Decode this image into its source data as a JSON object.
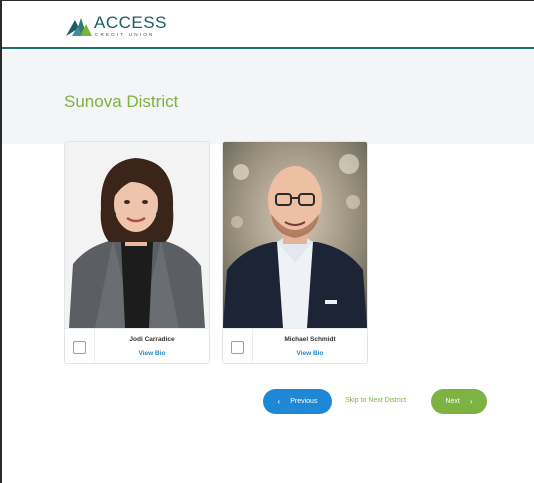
{
  "brand": {
    "name": "ACCESS",
    "subtitle": "CREDIT UNION",
    "colors": {
      "primary": "#1d5b66",
      "accent_green": "#7cb342",
      "accent_blue": "#1e88d6"
    }
  },
  "page": {
    "title": "Sunova District"
  },
  "candidates": [
    {
      "name": "Jodi Carradice",
      "bio_link": "View Bio",
      "selected": false,
      "photo_icon": "candidate-portrait"
    },
    {
      "name": "Michael Schmidt",
      "bio_link": "View Bio",
      "selected": false,
      "photo_icon": "candidate-portrait"
    }
  ],
  "navigation": {
    "previous_label": "Previous",
    "previous_icon": "chevron-left-icon",
    "skip_label": "Skip to Next District",
    "next_label": "Next",
    "next_icon": "chevron-right-icon"
  }
}
